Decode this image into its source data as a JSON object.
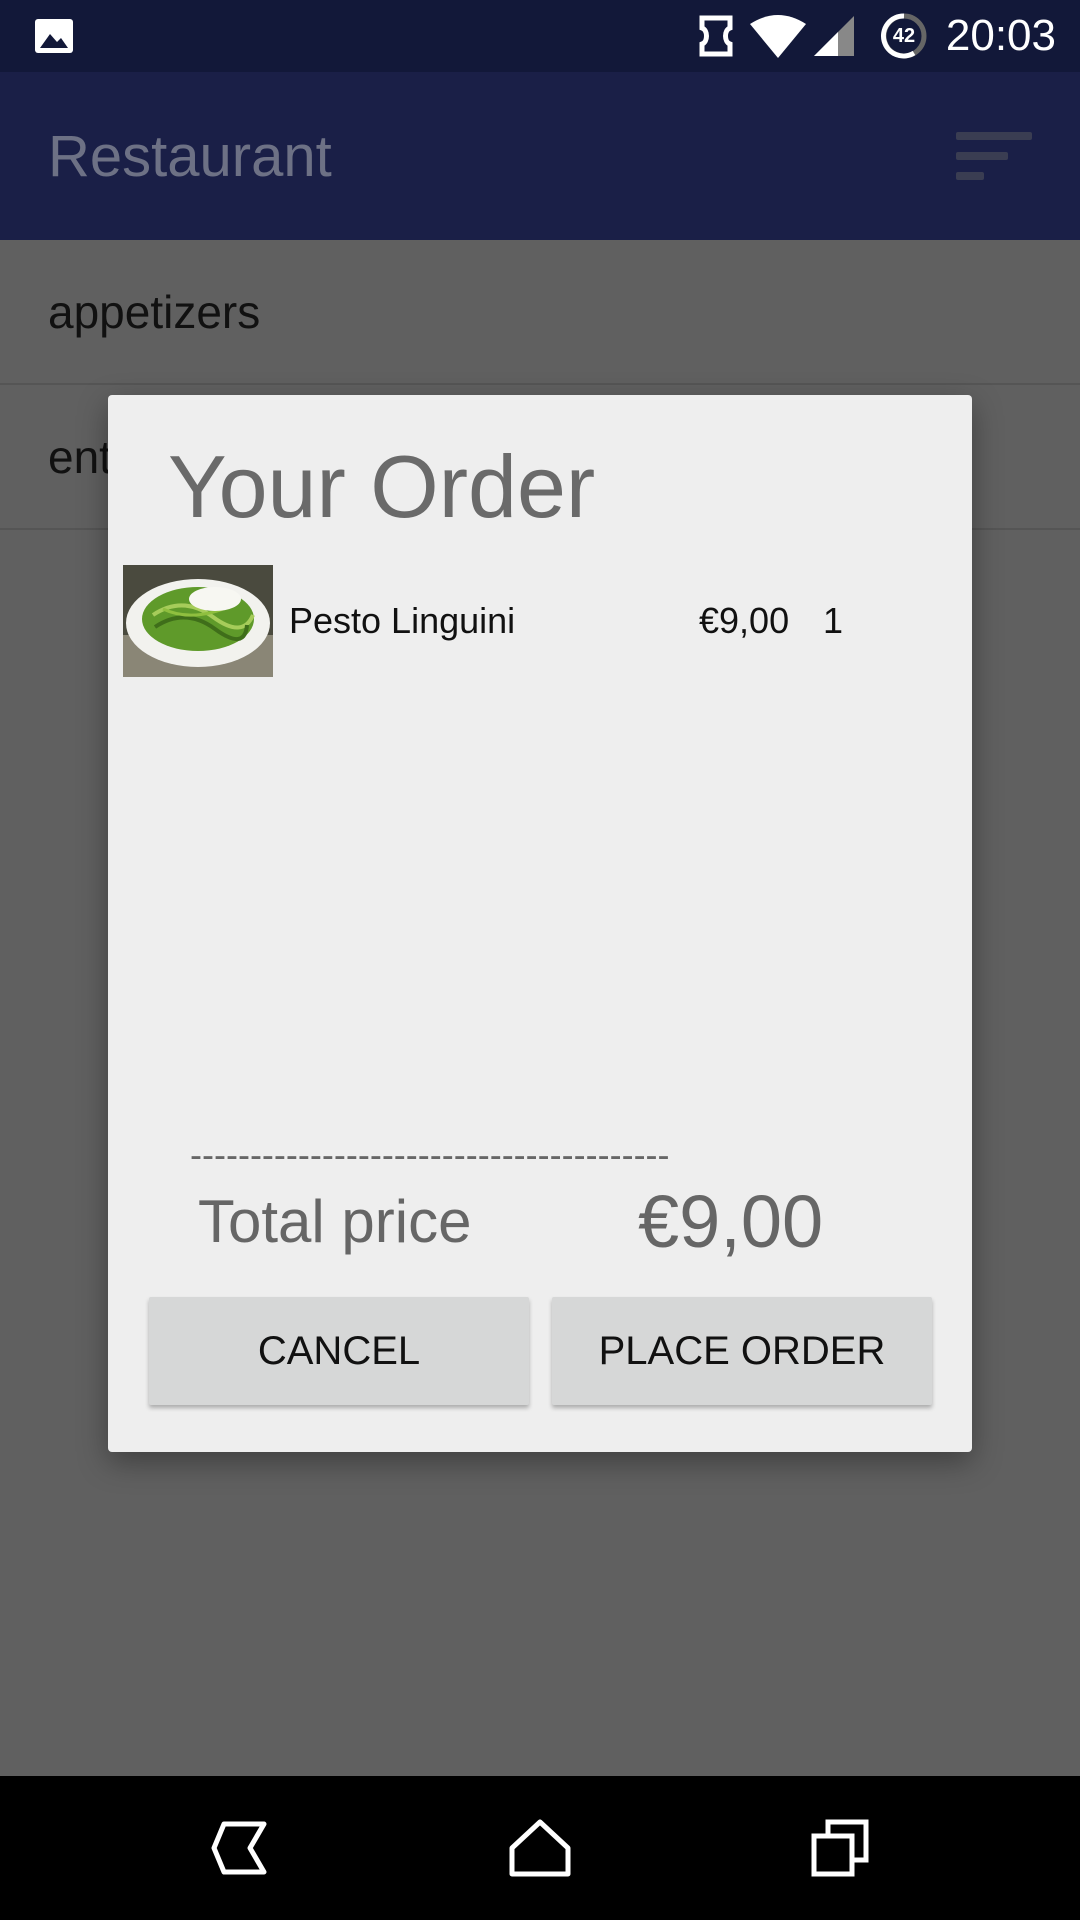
{
  "status_bar": {
    "time": "20:03",
    "battery_level": "42",
    "icons": [
      "gallery-icon",
      "sync-icon",
      "wifi-icon",
      "signal-icon",
      "battery-icon"
    ]
  },
  "app_bar": {
    "title": "Restaurant",
    "menu_icon": "filter-list-icon"
  },
  "categories": [
    {
      "label": "appetizers"
    },
    {
      "label": "entrees"
    }
  ],
  "dialog": {
    "title": "Your Order",
    "items": [
      {
        "name": "Pesto Linguini",
        "price": "€9,00",
        "quantity": "1",
        "image": "pasta-thumbnail"
      }
    ],
    "divider": "----------------------------------------",
    "total_label": "Total price",
    "total_value": "€9,00",
    "cancel_label": "CANCEL",
    "place_order_label": "PLACE ORDER"
  },
  "nav_bar": {
    "icons": [
      "back-icon",
      "home-icon",
      "recents-icon"
    ]
  },
  "colors": {
    "status_bar": "#121839",
    "app_bar": "#1a1f47",
    "dim_overlay": "#606060",
    "dialog_bg": "#eeeeee",
    "button_bg": "#d6d7d7"
  }
}
